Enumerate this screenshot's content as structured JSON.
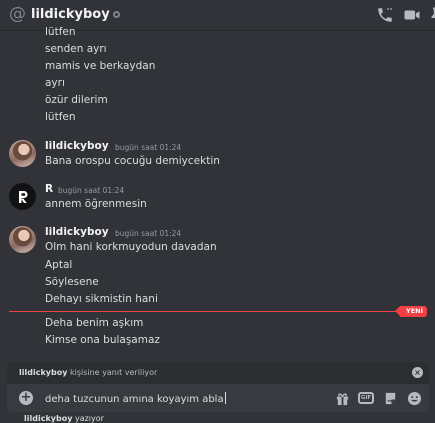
{
  "header": {
    "channel_name": "lildickyboy",
    "icons": [
      "at-icon",
      "status-offline-icon",
      "voice-call-icon",
      "video-call-icon",
      "pinned-messages-icon"
    ]
  },
  "messages": {
    "continuation_top": [
      "lütfen",
      "senden ayrı",
      "mamis ve berkaydan",
      "ayrı",
      "özür dilerim",
      "lütfen"
    ],
    "group1": {
      "author": "lildickyboy",
      "timestamp": "bugün saat 01:24",
      "lines": [
        "Bana orospu cocuğu demiycektin"
      ]
    },
    "group2": {
      "author": "R",
      "timestamp": "bugün saat 01:24",
      "lines": [
        "annem öğrenmesin"
      ]
    },
    "group3": {
      "author": "lildickyboy",
      "timestamp": "bugün saat 01:24",
      "lines": [
        "Olm hani korkmuyodun davadan",
        "Aptal",
        "Söylesene",
        "Dehayı sikmistin hani",
        "Deha benim aşkım",
        "Kimse ona bulaşamaz"
      ]
    },
    "new_divider_label": "YENİ"
  },
  "reply": {
    "username": "lildickyboy",
    "suffix": " kişisine yanıt veriliyor"
  },
  "composer": {
    "value": "deha tuzcunun amına koyayım abla",
    "gif_label": "GIF"
  },
  "typing": {
    "username": "lildickyboy",
    "suffix": " yazıyor"
  },
  "colors": {
    "background": "#313338",
    "composer": "#383a40",
    "new_divider": "#f23f43",
    "text": "#dbdee1",
    "muted": "#949ba4"
  }
}
